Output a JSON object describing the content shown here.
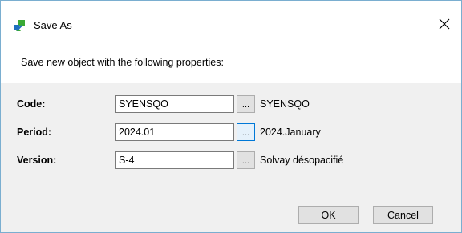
{
  "window": {
    "title": "Save As",
    "app_icon": "cube-export-icon",
    "close_glyph": "✕"
  },
  "prompt": "Save new object with the following properties:",
  "fields": [
    {
      "label": "Code:",
      "value": "SYENSQO",
      "browse_label": "...",
      "description": "SYENSQO"
    },
    {
      "label": "Period:",
      "value": "2024.01",
      "browse_label": "...",
      "description": "2024.January"
    },
    {
      "label": "Version:",
      "value": "S-4",
      "browse_label": "...",
      "description": "Solvay désopacifié"
    }
  ],
  "buttons": {
    "ok_label": "OK",
    "cancel_label": "Cancel"
  },
  "colors": {
    "window_border": "#7aaed0",
    "panel_background": "#f0f0f0",
    "focus_accent": "#0078d7",
    "icon_green": "#3aa935",
    "icon_blue": "#1f6fbf"
  }
}
